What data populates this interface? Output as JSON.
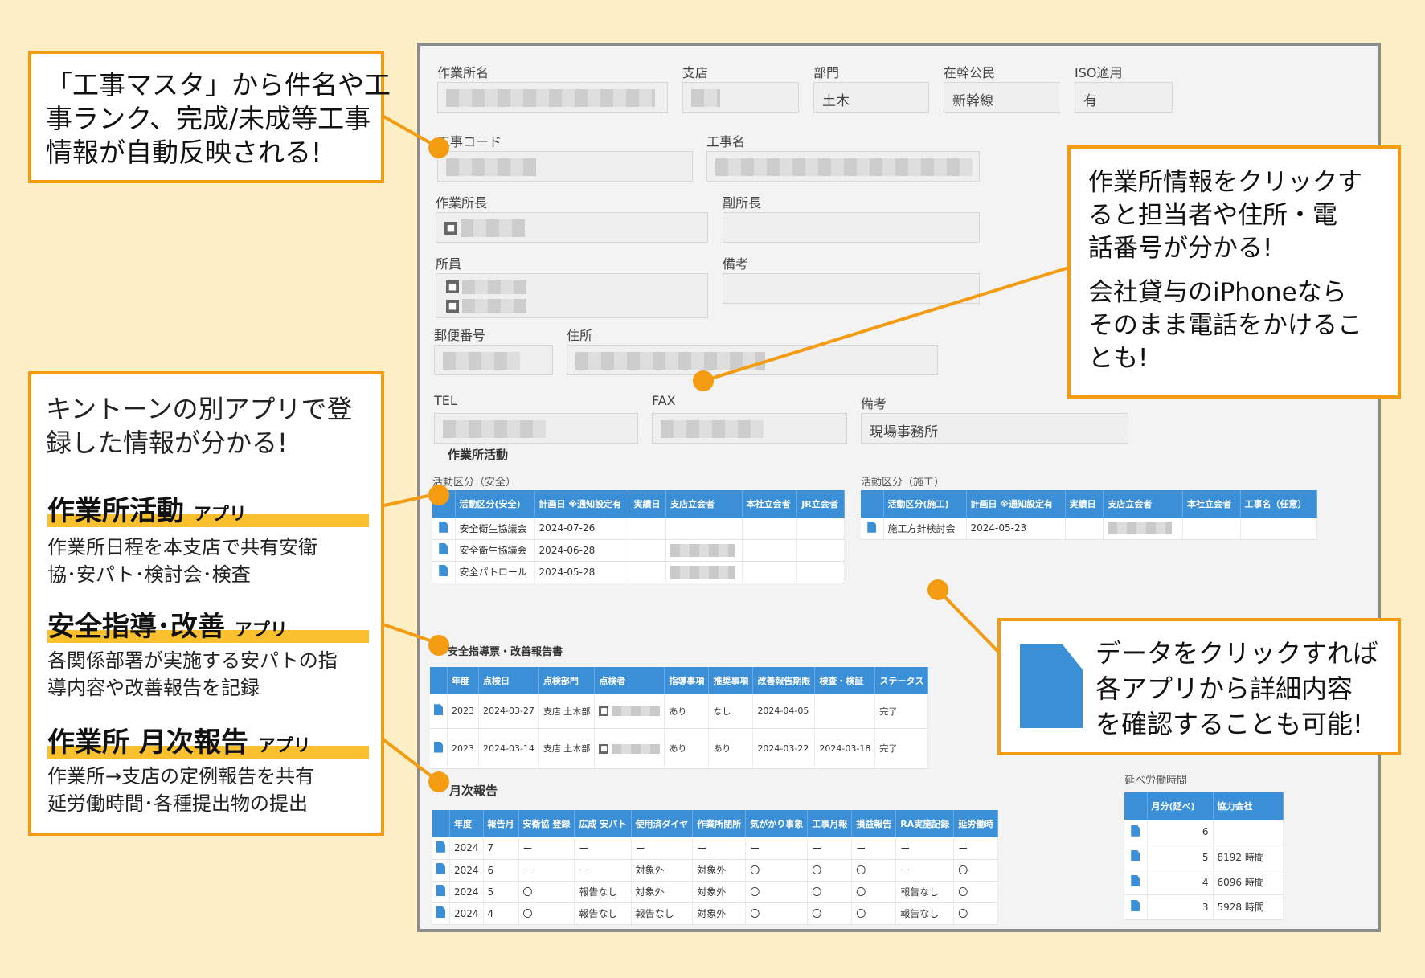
{
  "form": {
    "row1": [
      {
        "label": "作業所名",
        "value": ""
      },
      {
        "label": "支店",
        "value": ""
      },
      {
        "label": "部門",
        "value": "土木"
      },
      {
        "label": "在幹公民",
        "value": "新幹線"
      },
      {
        "label": "ISO適用",
        "value": "有"
      }
    ],
    "row2": [
      {
        "label": "工事コード"
      },
      {
        "label": "工事名"
      }
    ],
    "row3": [
      {
        "label": "作業所長"
      },
      {
        "label": "副所長"
      }
    ],
    "row4": [
      {
        "label": "所員"
      },
      {
        "label": "備考"
      }
    ],
    "row5": [
      {
        "label": "郵便番号"
      },
      {
        "label": "住所"
      }
    ],
    "row6": [
      {
        "label": "TEL"
      },
      {
        "label": "FAX"
      },
      {
        "label": "備考",
        "value": "現場事務所"
      }
    ]
  },
  "activity": {
    "title": "作業所活動",
    "safety_sub": "活動区分（安全）",
    "safety_headers": [
      "活動区分(安全)",
      "計画日 ※通知設定有",
      "実績日",
      "支店立会者",
      "本社立会者",
      "JR立会者"
    ],
    "safety_rows": [
      [
        "安全衛生協議会",
        "2024-07-26"
      ],
      [
        "安全衛生協議会",
        "2024-06-28"
      ],
      [
        "安全パトロール",
        "2024-05-28"
      ]
    ],
    "const_sub": "活動区分（施工）",
    "const_headers": [
      "活動区分(施工)",
      "計画日 ※通知設定有",
      "実績日",
      "支店立会者",
      "本社立会者",
      "工事名（任意）"
    ],
    "const_rows": [
      [
        "施工方針検討会",
        "2024-05-23"
      ]
    ]
  },
  "guidance": {
    "title": "安全指導票・改善報告書",
    "headers": [
      "年度",
      "点検日",
      "点検部門",
      "点検者",
      "指導事項",
      "推奨事項",
      "改善報告期限",
      "検査・検証",
      "ステータス"
    ],
    "rows": [
      [
        "2023",
        "2024-03-27",
        "支店 土木部",
        "あり",
        "なし",
        "2024-04-05",
        "",
        "完了"
      ],
      [
        "2023",
        "2024-03-14",
        "支店 土木部",
        "あり",
        "あり",
        "2024-03-22",
        "2024-03-18",
        "完了"
      ]
    ]
  },
  "monthly": {
    "title": "月次報告",
    "headers": [
      "年度",
      "報告月",
      "安衛協 登録",
      "広成 安パト",
      "使用済ダイヤ",
      "作業所閉所",
      "気がかり事象",
      "工事月報",
      "損益報告",
      "RA実施記録",
      "延労働時"
    ],
    "rows": [
      [
        "2024",
        "7",
        "ー",
        "ー",
        "ー",
        "ー",
        "ー",
        "ー",
        "ー",
        "ー",
        "ー"
      ],
      [
        "2024",
        "6",
        "ー",
        "ー",
        "対象外",
        "対象外",
        "〇",
        "〇",
        "〇",
        "ー",
        "〇"
      ],
      [
        "2024",
        "5",
        "〇",
        "報告なし",
        "対象外",
        "対象外",
        "〇",
        "〇",
        "〇",
        "報告なし",
        "〇"
      ],
      [
        "2024",
        "4",
        "〇",
        "報告なし",
        "報告なし",
        "対象外",
        "〇",
        "〇",
        "〇",
        "報告なし",
        "〇"
      ]
    ]
  },
  "labor": {
    "title": "延べ労働時間",
    "headers": [
      "月分(延べ)",
      "協力会社"
    ],
    "rows": [
      [
        "6",
        ""
      ],
      [
        "5",
        "8192 時間"
      ],
      [
        "4",
        "6096 時間"
      ],
      [
        "3",
        "5928 時間"
      ]
    ]
  },
  "callouts": {
    "top_left": [
      "「工事マスタ」から件名や工",
      "事ランク、完成/未成等工事",
      "情報が自動反映される!"
    ],
    "top_right_1": [
      "作業所情報をクリックす",
      "ると担当者や住所・電",
      "話番号が分かる!"
    ],
    "top_right_2": [
      "会社貸与のiPhoneなら",
      "そのまま電話をかけるこ",
      "とも!"
    ],
    "left_intro": [
      "キントーンの別アプリで登",
      "録した情報が分かる!"
    ],
    "app1_name": "作業所活動",
    "app1_suffix": "アプリ",
    "app1_desc": [
      "作業所日程を本支店で共有安衛",
      "協･安パト･検討会･検査"
    ],
    "app2_name": "安全指導･改善",
    "app2_suffix": "アプリ",
    "app2_desc": [
      "各関係部署が実施する安パトの指",
      "導内容や改善報告を記録"
    ],
    "app3_name": "作業所 月次報告",
    "app3_suffix": "アプリ",
    "app3_desc": [
      "作業所→支店の定例報告を共有",
      "延労働時間･各種提出物の提出"
    ],
    "data_click": [
      "データをクリックすれば",
      "各アプリから詳細内容",
      "を確認することも可能!"
    ]
  },
  "colors": {
    "accent": "#f39c12",
    "header_blue": "#3a8fd6",
    "background": "#fdefc5",
    "highlight": "#fbc02d"
  }
}
